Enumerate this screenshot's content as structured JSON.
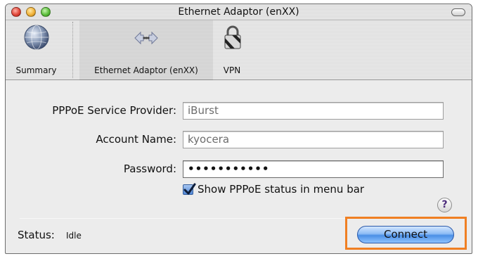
{
  "window": {
    "title": "Ethernet Adaptor (enXX)"
  },
  "toolbar": {
    "items": [
      {
        "label": "Summary",
        "icon": "globe-icon"
      },
      {
        "label": "Ethernet Adaptor (enXX)",
        "icon": "ethernet-icon"
      },
      {
        "label": "VPN",
        "icon": "lock-icon"
      }
    ]
  },
  "form": {
    "provider_label": "PPPoE Service Provider:",
    "provider_value": "iBurst",
    "account_label": "Account Name:",
    "account_value": "kyocera",
    "password_label": "Password:",
    "password_value": "•••••••••••",
    "show_status_label": "Show PPPoE status in menu bar",
    "show_status_checked": true
  },
  "help": {
    "label": "?"
  },
  "status": {
    "label": "Status:",
    "value": "Idle"
  },
  "actions": {
    "connect_label": "Connect"
  },
  "colors": {
    "highlight": "#f07f22",
    "button_blue": "#4b8fe6"
  }
}
